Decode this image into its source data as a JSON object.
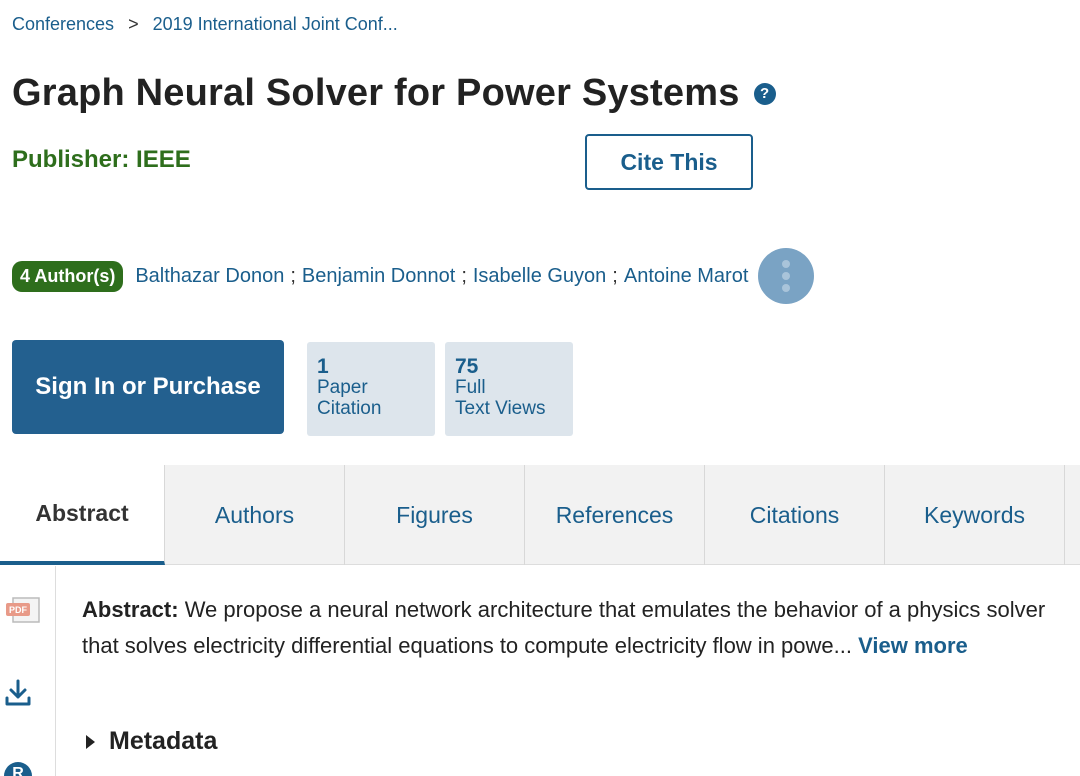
{
  "breadcrumb": {
    "item1": "Conferences",
    "sep": ">",
    "item2": "2019 International Joint Conf..."
  },
  "paper": {
    "title": "Graph Neural Solver for Power Systems",
    "help_glyph": "?",
    "publisher": "Publisher: IEEE"
  },
  "cite_label": "Cite This",
  "authors": {
    "badge": "4 Author(s)",
    "names": [
      "Balthazar Donon",
      "Benjamin Donnot",
      "Isabelle Guyon",
      "Antoine Marot"
    ],
    "separator": ";"
  },
  "signin_label": "Sign In or Purchase",
  "metrics": [
    {
      "value": "1",
      "line1": "Paper",
      "line2": "Citation"
    },
    {
      "value": "75",
      "line1": "Full",
      "line2": "Text Views"
    }
  ],
  "tabs": [
    "Abstract",
    "Authors",
    "Figures",
    "References",
    "Citations",
    "Keywords"
  ],
  "abstract": {
    "label": "Abstract:",
    "text": " We propose a neural network architecture that emulates the behavior of a physics solver that solves electricity differential equations to compute electricity flow in powe... ",
    "view_more": "View more"
  },
  "metadata_label": "Metadata",
  "side_icons": {
    "pdf_label": "PDF",
    "r_label": "R"
  },
  "colors": {
    "link": "#1a5e8c",
    "publisher": "#2e6e1c",
    "signin_bg": "#23608f",
    "metric_bg": "#dde5ec"
  }
}
